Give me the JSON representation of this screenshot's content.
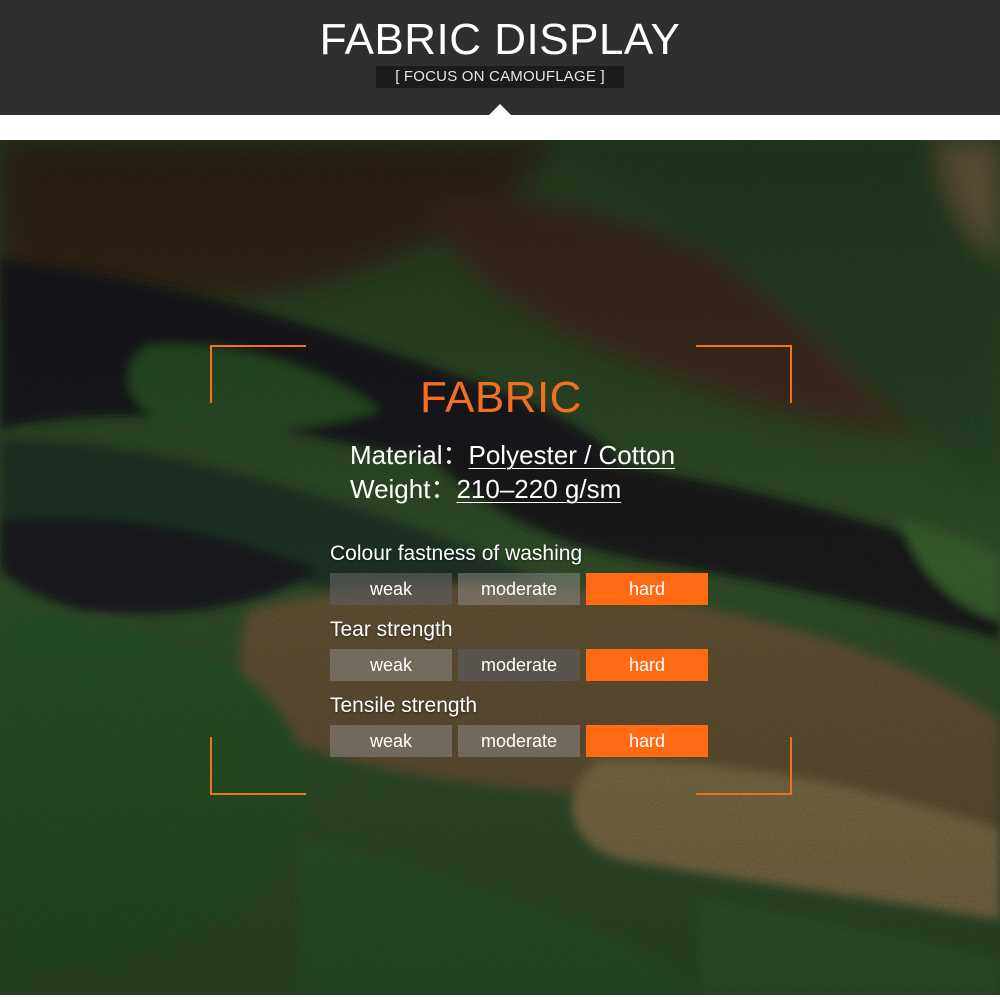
{
  "header": {
    "title": "FABRIC DISPLAY",
    "subtitle": "[ FOCUS ON CAMOUFLAGE ]"
  },
  "colors": {
    "header_bg": "#2f2f2f",
    "accent": "#f36f21",
    "rating_active": "#ff6a13",
    "rating_inactive": "#969696"
  },
  "panel": {
    "heading": "FABRIC",
    "specs": [
      {
        "label": "Material：",
        "value": "Polyester / Cotton"
      },
      {
        "label": "Weight：",
        "value": "210–220 g/sm"
      }
    ],
    "ratings": [
      {
        "label": "Colour fastness of washing",
        "levels": [
          "weak",
          "moderate",
          "hard"
        ],
        "selected": "hard"
      },
      {
        "label": "Tear strength",
        "levels": [
          "weak",
          "moderate",
          "hard"
        ],
        "selected": "hard"
      },
      {
        "label": "Tensile strength",
        "levels": [
          "weak",
          "moderate",
          "hard"
        ],
        "selected": "hard"
      }
    ]
  }
}
